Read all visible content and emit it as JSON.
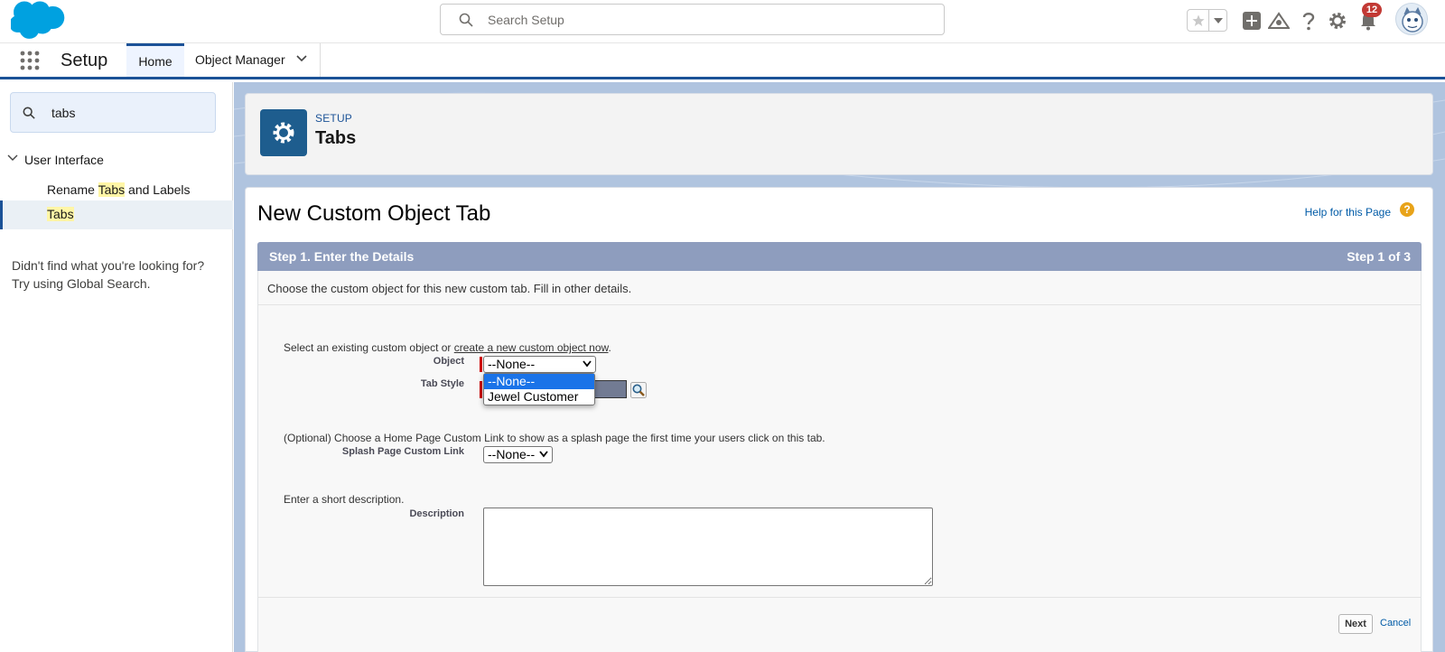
{
  "colors": {
    "brand": "#1b5297",
    "salesforce_blue": "#00a1e0",
    "step_bar": "#8e9dbe",
    "notification": "#c23934"
  },
  "header": {
    "search_placeholder": "Search Setup",
    "notification_count": "12"
  },
  "nav": {
    "app_name": "Setup",
    "tabs": [
      {
        "label": "Home"
      },
      {
        "label": "Object Manager"
      }
    ]
  },
  "sidebar": {
    "search_value": "tabs",
    "group_label": "User Interface",
    "items": [
      {
        "pre": "Rename ",
        "match": "Tabs",
        "post": " and Labels"
      },
      {
        "pre": "",
        "match": "Tabs",
        "post": ""
      }
    ],
    "help_line1": "Didn't find what you're looking for?",
    "help_line2": "Try using Global Search."
  },
  "page_header": {
    "eyebrow": "SETUP",
    "title": "Tabs"
  },
  "form": {
    "heading": "New Custom Object Tab",
    "help_link": "Help for this Page",
    "step_title": "Step 1. Enter the Details",
    "step_counter": "Step 1 of 3",
    "intro": "Choose the custom object for this new custom tab. Fill in other details.",
    "object_prompt_pre": "Select an existing custom object or ",
    "object_prompt_link": "create a new custom object now",
    "object_prompt_post": ".",
    "object_label": "Object",
    "object_selected": "--None--",
    "object_options": [
      "--None--",
      "Jewel Customer"
    ],
    "tab_style_label": "Tab Style",
    "splash_prompt": "(Optional) Choose a Home Page Custom Link to show as a splash page the first time your users click on this tab.",
    "splash_label": "Splash Page Custom Link",
    "splash_selected": "--None--",
    "description_prompt": "Enter a short description.",
    "description_label": "Description",
    "description_value": "",
    "next_label": "Next",
    "cancel_label": "Cancel"
  }
}
